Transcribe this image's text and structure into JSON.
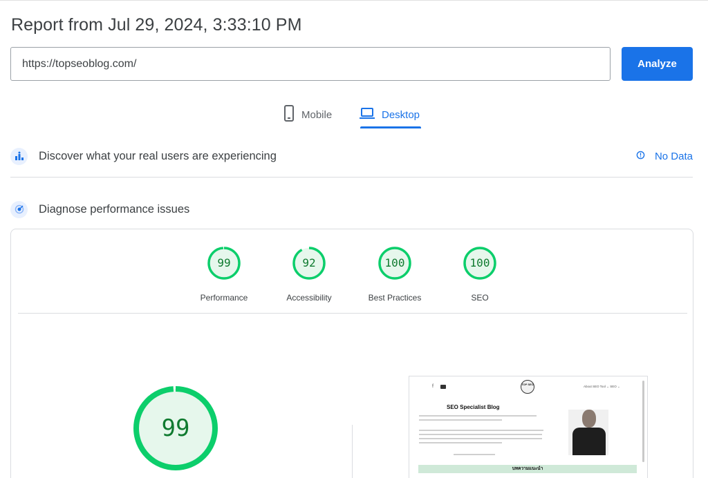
{
  "report": {
    "title": "Report from Jul 29, 2024, 3:33:10 PM"
  },
  "url_input": {
    "value": "https://topseoblog.com/"
  },
  "analyze_button": {
    "label": "Analyze"
  },
  "tabs": [
    {
      "label": "Mobile",
      "icon": "smartphone-icon",
      "active": false
    },
    {
      "label": "Desktop",
      "icon": "laptop-icon",
      "active": true
    }
  ],
  "discover": {
    "title": "Discover what your real users are experiencing",
    "status": "No Data",
    "status_icon": "info-icon"
  },
  "diagnose": {
    "title": "Diagnose performance issues"
  },
  "scores": [
    {
      "label": "Performance",
      "value": "99",
      "fraction": 0.99
    },
    {
      "label": "Accessibility",
      "value": "92",
      "fraction": 0.92
    },
    {
      "label": "Best Practices",
      "value": "100",
      "fraction": 1.0
    },
    {
      "label": "SEO",
      "value": "100",
      "fraction": 1.0
    }
  ],
  "big_score": {
    "value": "99",
    "fraction": 0.99
  },
  "screenshot_preview": {
    "logo_text": "TOP SEO",
    "nav_links": "About   SEO Tool ⌄   SEO ⌄",
    "heading": "SEO Specialist Blog",
    "section_bar": "บทความแนะนำ"
  },
  "colors": {
    "accent": "#1a73e8",
    "pass": "#0cce6b",
    "pass_text": "#0f7a2f",
    "pass_fill": "#e6f7ec"
  }
}
